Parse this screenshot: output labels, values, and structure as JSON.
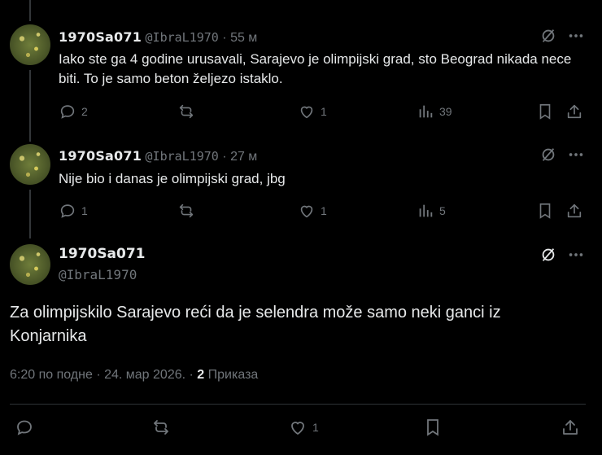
{
  "tweets": [
    {
      "name": "1970Sa071",
      "handle": "@IbraL1970",
      "separator": "·",
      "time": "55 м",
      "text": "Iako ste ga 4 godine urusavali, Sarajevo je olimpijski grad, sto Beograd nikada nece biti.  To je samo beton željezo istaklo.",
      "replies": "2",
      "reposts": "",
      "likes": "1",
      "views": "39"
    },
    {
      "name": "1970Sa071",
      "handle": "@IbraL1970",
      "separator": "·",
      "time": "27 м",
      "text": "Nije bio i danas je olimpijski grad, jbg",
      "replies": "1",
      "reposts": "",
      "likes": "1",
      "views": "5"
    }
  ],
  "main_tweet": {
    "name": "1970Sa071",
    "handle": "@IbraL1970",
    "text": "Za olimpijskilo Sarajevo reći da je selendra može samo neki ganci iz Konjarnika",
    "timestamp": "6:20 по подне · 24. мар 2026.",
    "separator": "·",
    "views_count": "2",
    "views_label": "Приказа",
    "likes": "1"
  },
  "icons": {
    "reply": "reply-bubble-icon",
    "repost": "repost-arrows-icon",
    "like": "heart-icon",
    "views": "bar-chart-icon",
    "bookmark": "bookmark-icon",
    "share": "share-upload-icon",
    "grok": "grok-slash-circle-icon",
    "more": "more-dots-icon"
  },
  "colors": {
    "background": "#000000",
    "text": "#e7e9ea",
    "muted": "#71767b",
    "divider": "#2f3336"
  }
}
